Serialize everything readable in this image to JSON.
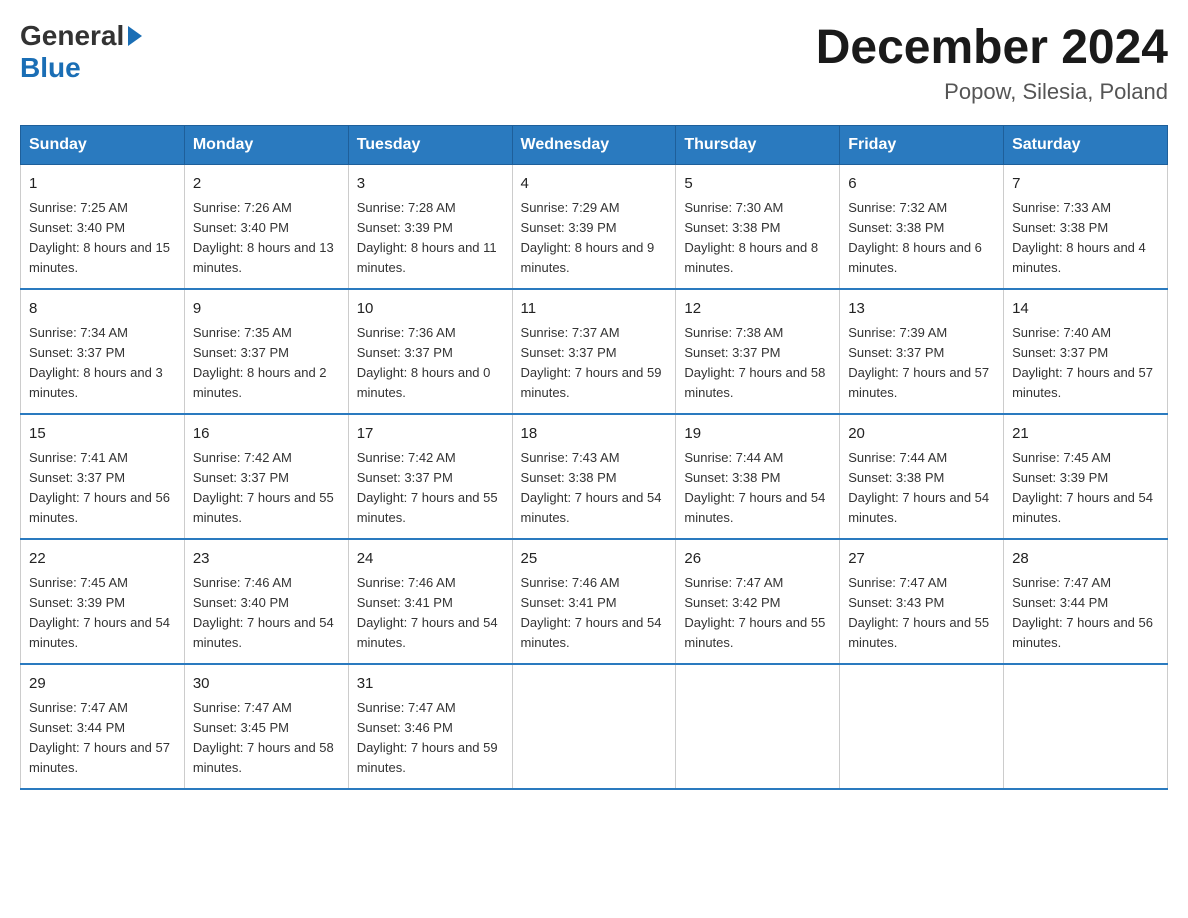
{
  "logo": {
    "general": "General",
    "blue": "Blue"
  },
  "title": "December 2024",
  "subtitle": "Popow, Silesia, Poland",
  "days_of_week": [
    "Sunday",
    "Monday",
    "Tuesday",
    "Wednesday",
    "Thursday",
    "Friday",
    "Saturday"
  ],
  "weeks": [
    [
      {
        "day": "1",
        "sunrise": "7:25 AM",
        "sunset": "3:40 PM",
        "daylight": "8 hours and 15 minutes."
      },
      {
        "day": "2",
        "sunrise": "7:26 AM",
        "sunset": "3:40 PM",
        "daylight": "8 hours and 13 minutes."
      },
      {
        "day": "3",
        "sunrise": "7:28 AM",
        "sunset": "3:39 PM",
        "daylight": "8 hours and 11 minutes."
      },
      {
        "day": "4",
        "sunrise": "7:29 AM",
        "sunset": "3:39 PM",
        "daylight": "8 hours and 9 minutes."
      },
      {
        "day": "5",
        "sunrise": "7:30 AM",
        "sunset": "3:38 PM",
        "daylight": "8 hours and 8 minutes."
      },
      {
        "day": "6",
        "sunrise": "7:32 AM",
        "sunset": "3:38 PM",
        "daylight": "8 hours and 6 minutes."
      },
      {
        "day": "7",
        "sunrise": "7:33 AM",
        "sunset": "3:38 PM",
        "daylight": "8 hours and 4 minutes."
      }
    ],
    [
      {
        "day": "8",
        "sunrise": "7:34 AM",
        "sunset": "3:37 PM",
        "daylight": "8 hours and 3 minutes."
      },
      {
        "day": "9",
        "sunrise": "7:35 AM",
        "sunset": "3:37 PM",
        "daylight": "8 hours and 2 minutes."
      },
      {
        "day": "10",
        "sunrise": "7:36 AM",
        "sunset": "3:37 PM",
        "daylight": "8 hours and 0 minutes."
      },
      {
        "day": "11",
        "sunrise": "7:37 AM",
        "sunset": "3:37 PM",
        "daylight": "7 hours and 59 minutes."
      },
      {
        "day": "12",
        "sunrise": "7:38 AM",
        "sunset": "3:37 PM",
        "daylight": "7 hours and 58 minutes."
      },
      {
        "day": "13",
        "sunrise": "7:39 AM",
        "sunset": "3:37 PM",
        "daylight": "7 hours and 57 minutes."
      },
      {
        "day": "14",
        "sunrise": "7:40 AM",
        "sunset": "3:37 PM",
        "daylight": "7 hours and 57 minutes."
      }
    ],
    [
      {
        "day": "15",
        "sunrise": "7:41 AM",
        "sunset": "3:37 PM",
        "daylight": "7 hours and 56 minutes."
      },
      {
        "day": "16",
        "sunrise": "7:42 AM",
        "sunset": "3:37 PM",
        "daylight": "7 hours and 55 minutes."
      },
      {
        "day": "17",
        "sunrise": "7:42 AM",
        "sunset": "3:37 PM",
        "daylight": "7 hours and 55 minutes."
      },
      {
        "day": "18",
        "sunrise": "7:43 AM",
        "sunset": "3:38 PM",
        "daylight": "7 hours and 54 minutes."
      },
      {
        "day": "19",
        "sunrise": "7:44 AM",
        "sunset": "3:38 PM",
        "daylight": "7 hours and 54 minutes."
      },
      {
        "day": "20",
        "sunrise": "7:44 AM",
        "sunset": "3:38 PM",
        "daylight": "7 hours and 54 minutes."
      },
      {
        "day": "21",
        "sunrise": "7:45 AM",
        "sunset": "3:39 PM",
        "daylight": "7 hours and 54 minutes."
      }
    ],
    [
      {
        "day": "22",
        "sunrise": "7:45 AM",
        "sunset": "3:39 PM",
        "daylight": "7 hours and 54 minutes."
      },
      {
        "day": "23",
        "sunrise": "7:46 AM",
        "sunset": "3:40 PM",
        "daylight": "7 hours and 54 minutes."
      },
      {
        "day": "24",
        "sunrise": "7:46 AM",
        "sunset": "3:41 PM",
        "daylight": "7 hours and 54 minutes."
      },
      {
        "day": "25",
        "sunrise": "7:46 AM",
        "sunset": "3:41 PM",
        "daylight": "7 hours and 54 minutes."
      },
      {
        "day": "26",
        "sunrise": "7:47 AM",
        "sunset": "3:42 PM",
        "daylight": "7 hours and 55 minutes."
      },
      {
        "day": "27",
        "sunrise": "7:47 AM",
        "sunset": "3:43 PM",
        "daylight": "7 hours and 55 minutes."
      },
      {
        "day": "28",
        "sunrise": "7:47 AM",
        "sunset": "3:44 PM",
        "daylight": "7 hours and 56 minutes."
      }
    ],
    [
      {
        "day": "29",
        "sunrise": "7:47 AM",
        "sunset": "3:44 PM",
        "daylight": "7 hours and 57 minutes."
      },
      {
        "day": "30",
        "sunrise": "7:47 AM",
        "sunset": "3:45 PM",
        "daylight": "7 hours and 58 minutes."
      },
      {
        "day": "31",
        "sunrise": "7:47 AM",
        "sunset": "3:46 PM",
        "daylight": "7 hours and 59 minutes."
      },
      null,
      null,
      null,
      null
    ]
  ]
}
